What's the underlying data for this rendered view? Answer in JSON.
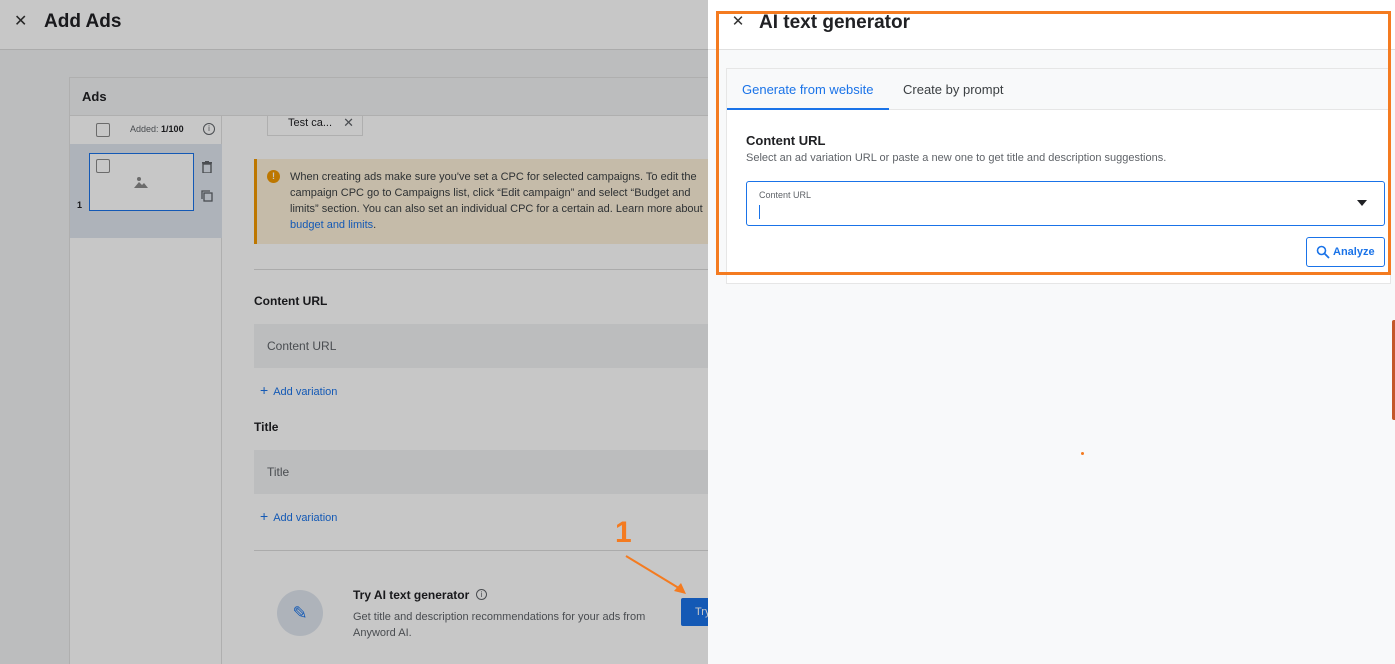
{
  "background": {
    "title": "Add Ads",
    "ads_panel_title": "Ads",
    "added_label": "Added:",
    "added_count": "1/100",
    "ad_number": "1",
    "chip_label": "Test ca...",
    "warning_text": "When creating ads make sure you've set a CPC for selected campaigns. To edit the campaign CPC go to Campaigns list, click “Edit campaign” and select “Budget and limits” section. You can also set an individual CPC for a certain ad. Learn more about",
    "warning_link": "budget and limits",
    "content_url_label": "Content URL",
    "content_url_placeholder": "Content URL",
    "add_variation": "Add variation",
    "title_label": "Title",
    "title_placeholder": "Title",
    "promo_title": "Try AI text generator",
    "promo_desc": "Get title and description recommendations for your ads from Anyword AI.",
    "try_button": "Try",
    "annotation_number": "1"
  },
  "drawer": {
    "title": "AI text generator",
    "tabs": [
      {
        "label": "Generate from website",
        "active": true
      },
      {
        "label": "Create by prompt",
        "active": false
      }
    ],
    "section_title": "Content URL",
    "section_desc": "Select an ad variation URL or paste a new one to get title and description suggestions.",
    "url_field_label": "Content URL",
    "url_field_value": "",
    "analyze_button": "Analyze"
  },
  "colors": {
    "accent": "#1a73e8",
    "annotation": "#f47b20",
    "warning": "#f29900"
  }
}
